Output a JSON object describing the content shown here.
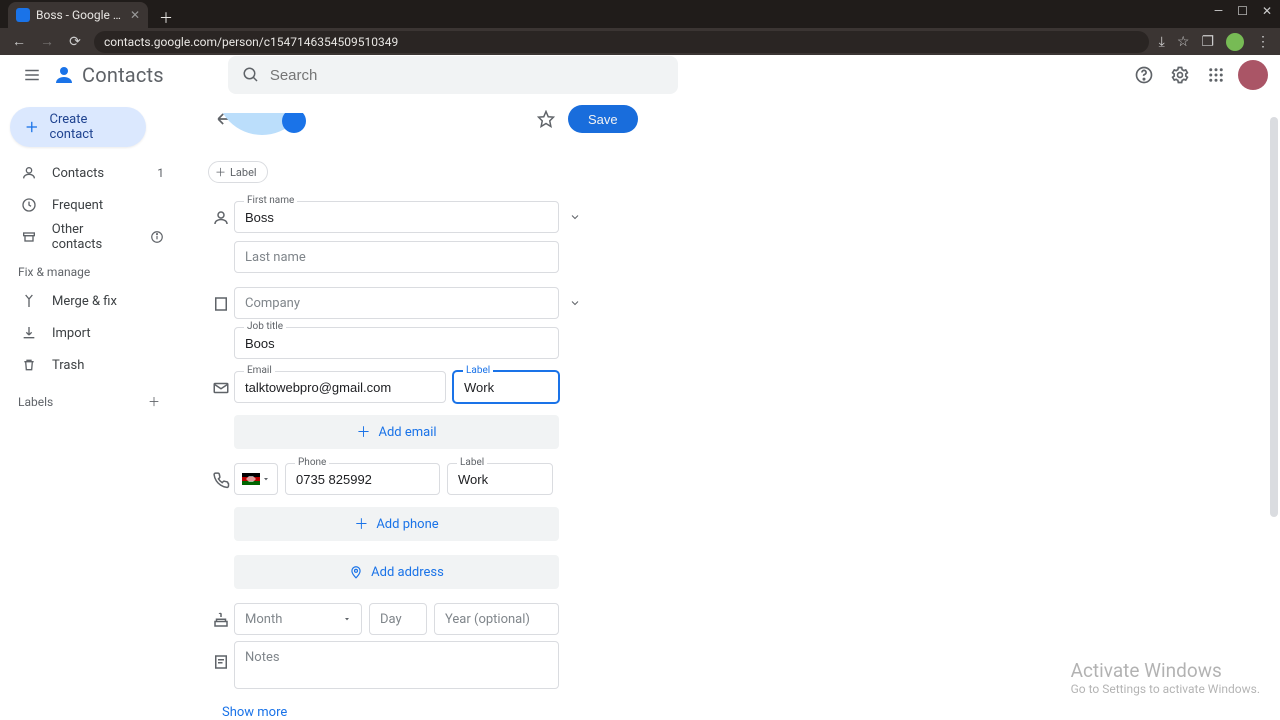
{
  "browser": {
    "tab_title": "Boss - Google Contacts",
    "url": "contacts.google.com/person/c1547146354509510349"
  },
  "header": {
    "app_name": "Contacts",
    "search_placeholder": "Search"
  },
  "sidebar": {
    "create_label": "Create contact",
    "items": [
      {
        "label": "Contacts",
        "count": "1"
      },
      {
        "label": "Frequent"
      },
      {
        "label": "Other contacts"
      }
    ],
    "fix_manage_header": "Fix & manage",
    "fix_items": [
      {
        "label": "Merge & fix"
      },
      {
        "label": "Import"
      },
      {
        "label": "Trash"
      }
    ],
    "labels_header": "Labels"
  },
  "editor": {
    "save_label": "Save",
    "label_chip": "Label",
    "name": {
      "first_label": "First name",
      "first_value": "Boss",
      "last_placeholder": "Last name"
    },
    "company": {
      "company_placeholder": "Company",
      "jobtitle_label": "Job title",
      "jobtitle_value": "Boos"
    },
    "email": {
      "label": "Email",
      "value": "talktowebpro@gmail.com",
      "type_label": "Label",
      "type_value": "Work",
      "add_label": "Add email"
    },
    "phone": {
      "label": "Phone",
      "value": "0735 825992",
      "type_label": "Label",
      "type_value": "Work",
      "add_label": "Add phone"
    },
    "address": {
      "add_label": "Add address"
    },
    "birthday": {
      "month_placeholder": "Month",
      "day_placeholder": "Day",
      "year_placeholder": "Year (optional)"
    },
    "notes_placeholder": "Notes",
    "show_more": "Show more"
  },
  "watermark": {
    "line1": "Activate Windows",
    "line2": "Go to Settings to activate Windows."
  }
}
